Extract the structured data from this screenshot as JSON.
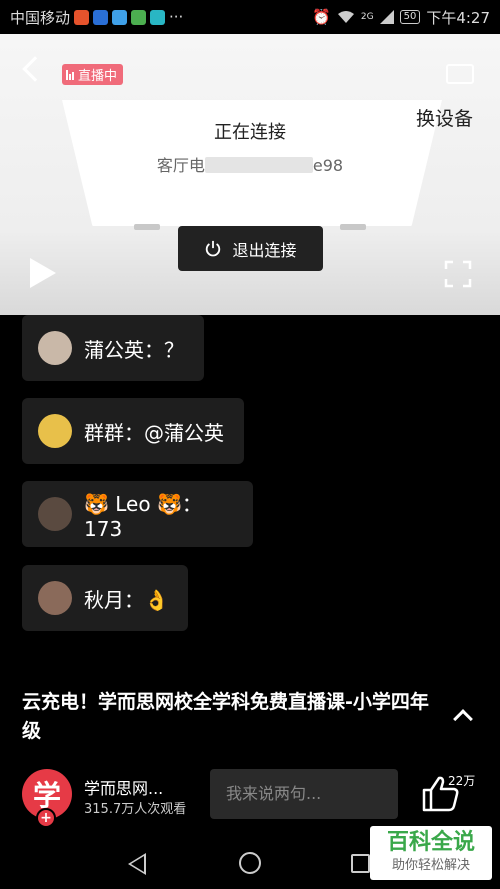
{
  "status_bar": {
    "carrier": "中国移动",
    "app_icons": [
      "weibo-icon",
      "shield-icon",
      "app-icon",
      "play-store-icon",
      "browser-icon"
    ],
    "more": "···",
    "signal_label": "2G",
    "battery": "50",
    "time": "下午4:27"
  },
  "player": {
    "live_badge": "直播中",
    "switch_device": "换设备",
    "tv_status": "正在连接",
    "tv_name_prefix": "客厅电",
    "tv_name_suffix": "e98",
    "disconnect_label": "退出连接"
  },
  "comments": [
    {
      "user": "蒲公英",
      "text": "蒲公英：？",
      "avatar_color": "#c9b8a8"
    },
    {
      "user": "群群",
      "text": "群群：@蒲公英",
      "avatar_color": "#e8c04a"
    },
    {
      "user": "Leo",
      "text": "🐯 Leo 🐯：173",
      "avatar_color": "#5a4a40"
    },
    {
      "user": "秋月",
      "text": "秋月：👌",
      "avatar_color": "#8a6a5a"
    }
  ],
  "video": {
    "title": "云充电！学而思网校全学科免费直播课-小学四年级"
  },
  "channel": {
    "logo_char": "学",
    "logo_plus": "+",
    "name": "学而思网...",
    "views": "315.7万人次观看"
  },
  "comment_input": {
    "placeholder": "我来说两句..."
  },
  "like": {
    "count": "22万"
  },
  "watermark": {
    "main": "百科全说",
    "sub": "助你轻松解决"
  },
  "colors": {
    "live_badge": "#f06b7a",
    "channel_logo": "#e63a46",
    "watermark_green": "#3aa84a"
  }
}
